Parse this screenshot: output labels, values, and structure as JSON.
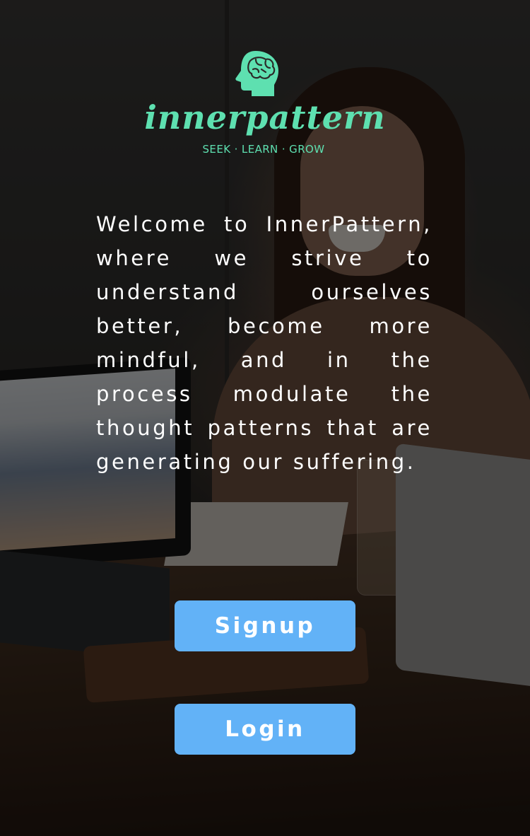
{
  "app": {
    "brand_name": "innerpattern",
    "tagline": "SEEK · LEARN · GROW",
    "brand_color": "#5ee0b0",
    "logo_icon": "brain-head-icon"
  },
  "welcome": {
    "text": "Welcome to InnerPattern, where we strive to understand ourselves better, become more mindful, and in the process modulate the thought patterns that are generating our suffering."
  },
  "actions": {
    "signup_label": "Signup",
    "login_label": "Login",
    "button_color": "#62b2f7"
  }
}
